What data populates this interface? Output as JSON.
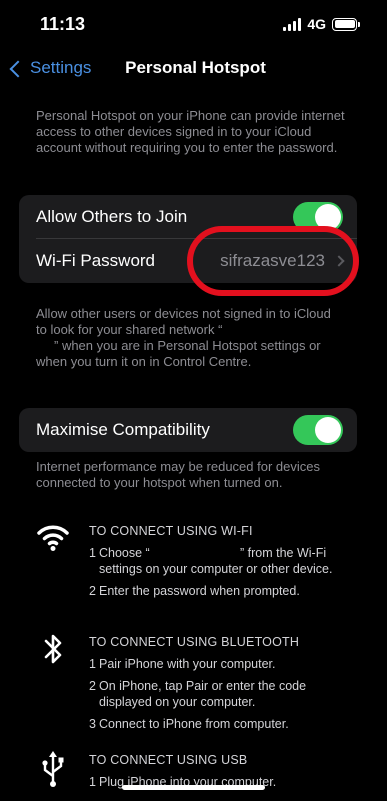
{
  "status_bar": {
    "time": "11:13",
    "network": "4G"
  },
  "nav": {
    "back_label": "Settings",
    "title": "Personal Hotspot"
  },
  "intro_text": "Personal Hotspot on your iPhone can provide internet access to other devices signed in to your iCloud account without requiring you to enter the password.",
  "allow_group": {
    "allow_label": "Allow Others to Join",
    "allow_on": true,
    "password_label": "Wi-Fi Password",
    "password_value": "sifrazasve123"
  },
  "allow_footer": {
    "line1": "Allow other users or devices not signed in to iCloud",
    "line2": "to look for your shared network “",
    "line3": "” when you are in Personal Hotspot settings or",
    "line4": "when you turn it on in Control Centre."
  },
  "compat_group": {
    "label": "Maximise Compatibility",
    "on": true
  },
  "compat_footer": "Internet performance may be reduced for devices connected to your hotspot when turned on.",
  "instructions": {
    "wifi": {
      "heading": "TO CONNECT USING WI-FI",
      "step1_num": "1",
      "step1": "Choose “                          ” from the Wi-Fi settings on your computer or other device.",
      "step2_num": "2",
      "step2": "Enter the password when prompted."
    },
    "bluetooth": {
      "heading": "TO CONNECT USING BLUETOOTH",
      "step1_num": "1",
      "step1": "Pair iPhone with your computer.",
      "step2_num": "2",
      "step2": "On iPhone, tap Pair or enter the code displayed on your computer.",
      "step3_num": "3",
      "step3": "Connect to iPhone from computer."
    },
    "usb": {
      "heading": "TO CONNECT USING USB",
      "step1_num": "1",
      "step1": "Plug iPhone into your computer."
    }
  },
  "colors": {
    "accent": "#4a90e2",
    "toggle_on": "#34c759",
    "annotation": "#e3101e"
  }
}
